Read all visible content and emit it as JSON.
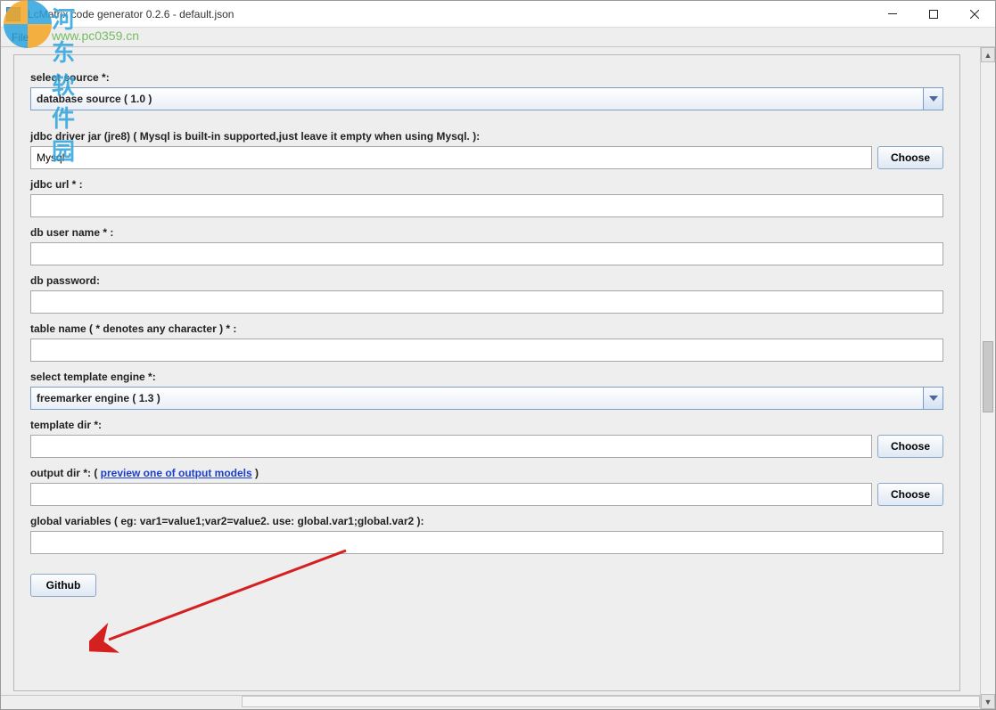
{
  "window": {
    "title": "LcMatrix code generator 0.2.6 - default.json"
  },
  "menu": {
    "file": "File"
  },
  "labels": {
    "selectSource": "select source *:",
    "jdbcDriver": "jdbc driver jar (jre8) ( Mysql is built-in supported,just leave it empty when using Mysql. ):",
    "jdbcUrl": "jdbc url * :",
    "dbUser": "db user name * :",
    "dbPassword": "db password:",
    "tableName": "table name ( * denotes any character ) * :",
    "selectEngine": "select template engine *:",
    "templateDir": "template dir *:",
    "outputDir": "output dir *:  ( ",
    "outputDirLink": "preview one of output models",
    "outputDirEnd": " )",
    "globalVars": "global variables ( eg: var1=value1;var2=value2. use: global.var1;global.var2 ):"
  },
  "values": {
    "source": "database source ( 1.0 )",
    "jdbcDriver": "Mysql",
    "jdbcUrl": "",
    "dbUser": "",
    "dbPassword": "",
    "tableName": "",
    "engine": "freemarker engine ( 1.3 )",
    "templateDir": "",
    "outputDir": "",
    "globalVars": ""
  },
  "buttons": {
    "choose": "Choose",
    "github": "Github"
  },
  "watermark": {
    "text1": "河东软件园",
    "text2": "www.pc0359.cn"
  }
}
